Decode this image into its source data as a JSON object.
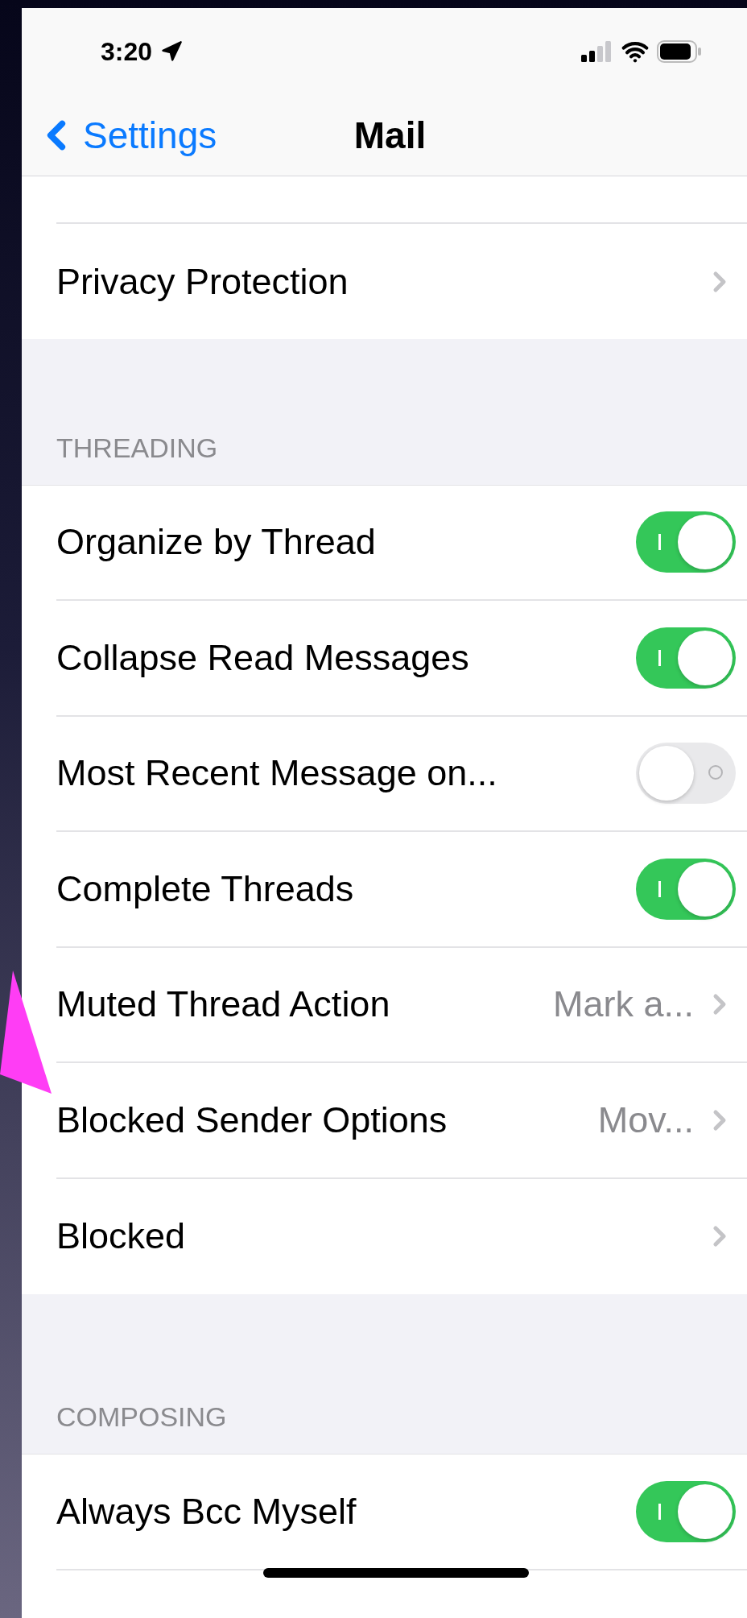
{
  "status_bar": {
    "time": "3:20"
  },
  "nav": {
    "back": "Settings",
    "title": "Mail"
  },
  "sections": [
    {
      "rows": [
        {
          "kind": "link",
          "label": "Privacy Protection"
        }
      ]
    },
    {
      "header": "THREADING",
      "rows": [
        {
          "kind": "toggle",
          "label": "Organize by Thread",
          "on": true
        },
        {
          "kind": "toggle",
          "label": "Collapse Read Messages",
          "on": true
        },
        {
          "kind": "toggle",
          "label": "Most Recent Message on...",
          "on": false
        },
        {
          "kind": "toggle",
          "label": "Complete Threads",
          "on": true
        },
        {
          "kind": "link",
          "label": "Muted Thread Action",
          "value": "Mark a..."
        },
        {
          "kind": "link",
          "label": "Blocked Sender Options",
          "value": "Mov..."
        },
        {
          "kind": "link",
          "label": "Blocked"
        }
      ]
    },
    {
      "header": "COMPOSING",
      "rows": [
        {
          "kind": "toggle",
          "label": "Always Bcc Myself",
          "on": true
        }
      ]
    }
  ]
}
